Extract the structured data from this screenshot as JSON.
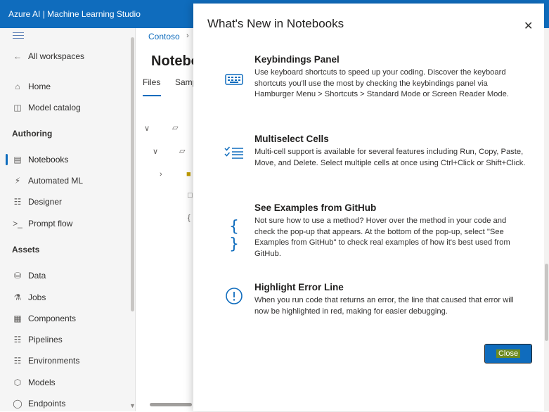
{
  "app": {
    "title": "Azure AI | Machine Learning Studio"
  },
  "nav": {
    "back": "All workspaces",
    "items_top": [
      {
        "label": "Home",
        "icon": "home-icon"
      },
      {
        "label": "Model catalog",
        "icon": "model-catalog-icon"
      }
    ],
    "authoring_header": "Authoring",
    "authoring": [
      {
        "label": "Notebooks",
        "icon": "notebook-icon"
      },
      {
        "label": "Automated ML",
        "icon": "automl-icon"
      },
      {
        "label": "Designer",
        "icon": "designer-icon"
      },
      {
        "label": "Prompt flow",
        "icon": "prompt-flow-icon"
      }
    ],
    "assets_header": "Assets",
    "assets": [
      {
        "label": "Data",
        "icon": "data-icon"
      },
      {
        "label": "Jobs",
        "icon": "jobs-icon"
      },
      {
        "label": "Components",
        "icon": "components-icon"
      },
      {
        "label": "Pipelines",
        "icon": "pipelines-icon"
      },
      {
        "label": "Environments",
        "icon": "environments-icon"
      },
      {
        "label": "Models",
        "icon": "models-icon"
      },
      {
        "label": "Endpoints",
        "icon": "endpoints-icon"
      }
    ]
  },
  "main": {
    "breadcrumb": "Contoso",
    "page_title": "Notebo",
    "tabs": [
      "Files",
      "Samp"
    ]
  },
  "dialog": {
    "title": "What's New in Notebooks",
    "features": [
      {
        "title": "Keybindings Panel",
        "icon": "keyboard-icon",
        "text": "Use keyboard shortcuts to speed up your coding. Discover the keyboard shortcuts you'll use the most by checking the keybindings panel via Hamburger Menu > Shortcuts > Standard Mode or Screen Reader Mode."
      },
      {
        "title": "Multiselect Cells",
        "icon": "multiselect-icon",
        "text": "Multi-cell support is available for several features including Run, Copy, Paste, Move, and Delete. Select multiple cells at once using Ctrl+Click or Shift+Click."
      },
      {
        "title": "See Examples from GitHub",
        "icon": "code-braces-icon",
        "text": "Not sure how to use a method? Hover over the method in your code and check the pop-up that appears. At the bottom of the pop-up, select \"See Examples from GitHub\" to check real examples of how it's best used from GitHub."
      },
      {
        "title": "Highlight Error Line",
        "icon": "error-icon",
        "text": "When you run code that returns an error, the line that caused that error will now be highlighted in red, making for easier debugging."
      }
    ],
    "close_button": "Close"
  },
  "colors": {
    "accent": "#0f6cbd",
    "header": "#0f6cbd"
  }
}
